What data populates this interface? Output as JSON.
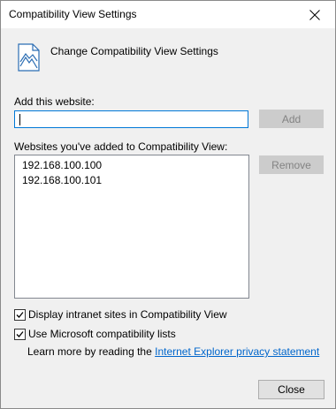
{
  "window": {
    "title": "Compatibility View Settings"
  },
  "header": {
    "text": "Change Compatibility View Settings"
  },
  "add_website": {
    "label": "Add this website:",
    "value": "",
    "add_button": "Add"
  },
  "websites": {
    "label": "Websites you've added to Compatibility View:",
    "items": [
      "192.168.100.100",
      "192.168.100.101"
    ],
    "remove_button": "Remove"
  },
  "options": {
    "display_intranet": {
      "label": "Display intranet sites in Compatibility View",
      "checked": true
    },
    "use_ms_lists": {
      "label": "Use Microsoft compatibility lists",
      "checked": true
    }
  },
  "learn_more": {
    "prefix": "Learn more by reading the",
    "link": "Internet Explorer privacy statement"
  },
  "footer": {
    "close_button": "Close"
  }
}
